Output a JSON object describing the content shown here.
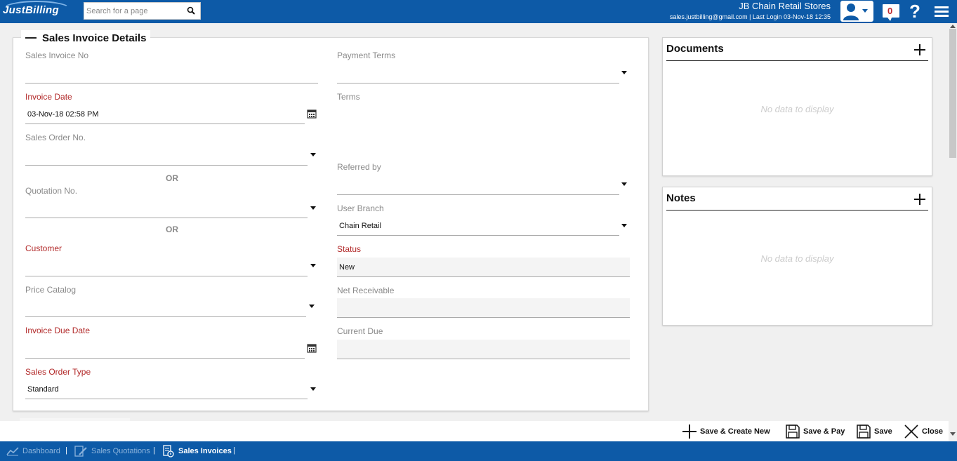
{
  "header": {
    "logo_text": "JustBilling",
    "search_placeholder": "Search for a page",
    "company_name": "JB Chain Retail Stores",
    "user_line": "sales.justbilling@gmail.com | Last Login 03-Nov-18 12:35",
    "notification_count": "0",
    "help_glyph": "?"
  },
  "form": {
    "legend": "Sales Invoice Details",
    "left": {
      "sales_invoice_no": {
        "label": "Sales Invoice No",
        "value": ""
      },
      "invoice_date": {
        "label": "Invoice Date",
        "value": "03-Nov-18 02:58 PM"
      },
      "sales_order_no": {
        "label": "Sales Order No.",
        "value": ""
      },
      "or1": "OR",
      "quotation_no": {
        "label": "Quotation No.",
        "value": ""
      },
      "or2": "OR",
      "customer": {
        "label": "Customer",
        "value": ""
      },
      "price_catalog": {
        "label": "Price Catalog",
        "value": ""
      },
      "invoice_due_date": {
        "label": "Invoice Due Date",
        "value": ""
      },
      "sales_order_type": {
        "label": "Sales Order Type",
        "value": "Standard"
      }
    },
    "right": {
      "payment_terms": {
        "label": "Payment Terms",
        "value": ""
      },
      "terms": {
        "label": "Terms",
        "value": ""
      },
      "referred_by": {
        "label": "Referred by",
        "value": ""
      },
      "user_branch": {
        "label": "User Branch",
        "value": "Chain Retail"
      },
      "status": {
        "label": "Status",
        "value": "New"
      },
      "net_receivable": {
        "label": "Net Receivable",
        "value": ""
      },
      "current_due": {
        "label": "Current Due",
        "value": ""
      }
    }
  },
  "documents": {
    "title": "Documents",
    "empty": "No data to display"
  },
  "notes": {
    "title": "Notes",
    "empty": "No data to display"
  },
  "actions": {
    "save_create_new": "Save & Create New",
    "save_pay": "Save & Pay",
    "save": "Save",
    "close": "Close"
  },
  "breadcrumbs": [
    {
      "label": "Dashboard",
      "icon": "chart-icon"
    },
    {
      "label": "Sales Quotations",
      "icon": "quotation-icon"
    },
    {
      "label": "Sales Invoices",
      "icon": "invoice-icon"
    }
  ],
  "colors": {
    "brand_blue": "#0d5aa7",
    "required_label": "#b22a2a"
  }
}
